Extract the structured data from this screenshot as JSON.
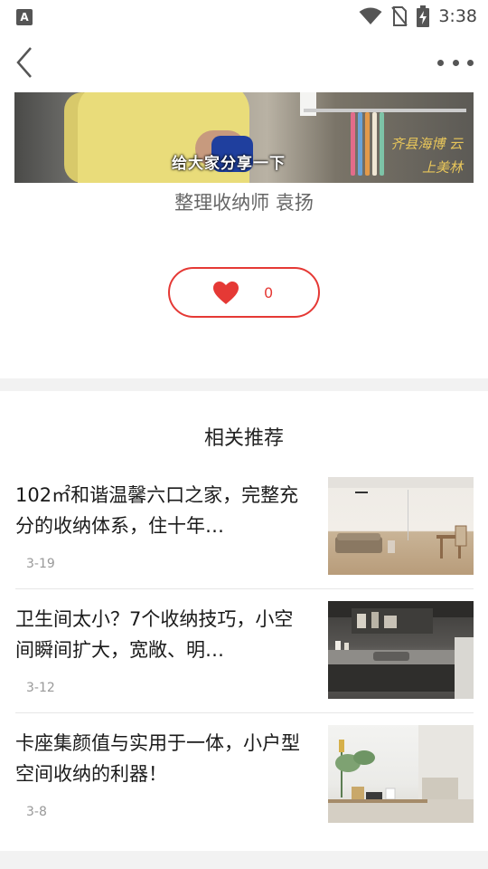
{
  "status_bar": {
    "app_icon_letter": "A",
    "time": "3:38"
  },
  "video": {
    "caption": "给大家分享一下",
    "overlay_calligraphy": "齐县海博 云上美林"
  },
  "article": {
    "subtitle": "整理收纳师 袁扬"
  },
  "like": {
    "count": "0"
  },
  "recommend": {
    "title": "相关推荐",
    "items": [
      {
        "title": "102㎡和谐温馨六口之家，完整充分的收纳体系，住十年…",
        "date": "3-19"
      },
      {
        "title": "卫生间太小？7个收纳技巧，小空间瞬间扩大，宽敞、明…",
        "date": "3-12"
      },
      {
        "title": "卡座集颜值与实用于一体，小户型空间收纳的利器！",
        "date": "3-8"
      }
    ]
  },
  "colors": {
    "accent": "#e53935",
    "divider": "#f2f2f2"
  }
}
